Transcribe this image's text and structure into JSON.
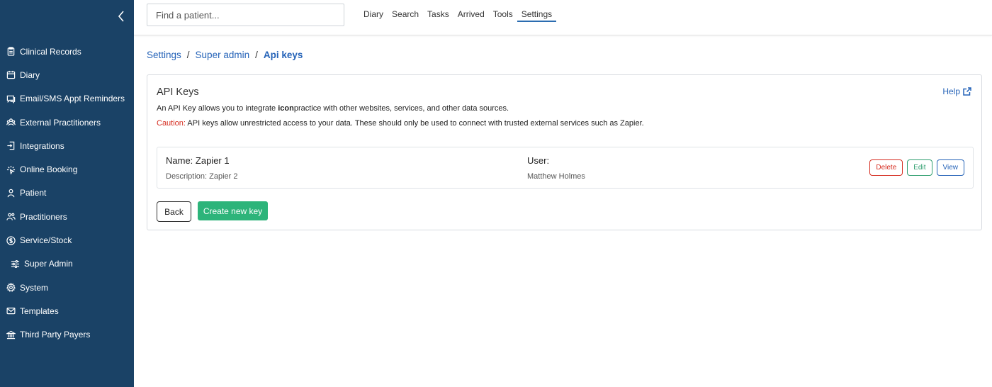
{
  "sidebar": {
    "items": [
      {
        "label": "Clinical Records",
        "icon": "clipboard-icon"
      },
      {
        "label": "Diary",
        "icon": "calendar-icon"
      },
      {
        "label": "Email/SMS Appt Reminders",
        "icon": "message-icon"
      },
      {
        "label": "External Practitioners",
        "icon": "users-icon"
      },
      {
        "label": "Integrations",
        "icon": "plug-icon"
      },
      {
        "label": "Online Booking",
        "icon": "sparkle-icon"
      },
      {
        "label": "Patient",
        "icon": "user-icon"
      },
      {
        "label": "Practitioners",
        "icon": "people-icon"
      },
      {
        "label": "Service/Stock",
        "icon": "dollar-icon"
      },
      {
        "label": "Super Admin",
        "icon": "sliders-icon"
      },
      {
        "label": "System",
        "icon": "gear-icon"
      },
      {
        "label": "Templates",
        "icon": "envelope-icon"
      },
      {
        "label": "Third Party Payers",
        "icon": "bank-icon"
      }
    ]
  },
  "search": {
    "placeholder": "Find a patient..."
  },
  "topnav": {
    "items": [
      "Diary",
      "Search",
      "Tasks",
      "Arrived",
      "Tools",
      "Settings"
    ],
    "active": "Settings"
  },
  "breadcrumb": {
    "settings": "Settings",
    "super_admin": "Super admin",
    "current": "Api keys",
    "separator": "/"
  },
  "card": {
    "title": "API Keys",
    "help": "Help",
    "desc_prefix": "An API Key allows you to integrate ",
    "desc_brand": "icon",
    "desc_suffix": "practice with other websites, services, and other data sources.",
    "caution_label": "Caution:",
    "caution_text": " API keys allow unrestricted access to your data. These should only be used to connect with trusted external services such as Zapier."
  },
  "api_key": {
    "name": "Name: Zapier 1",
    "description": "Description: Zapier 2",
    "user_label": "User:",
    "user": "Matthew Holmes",
    "delete_label": "Delete",
    "edit_label": "Edit",
    "view_label": "View"
  },
  "actions": {
    "back_label": "Back",
    "create_label": "Create new key"
  },
  "colors": {
    "sidebar_bg": "#1a4266",
    "link": "#2563b8",
    "danger": "#d52b1e",
    "success": "#2db47a"
  }
}
